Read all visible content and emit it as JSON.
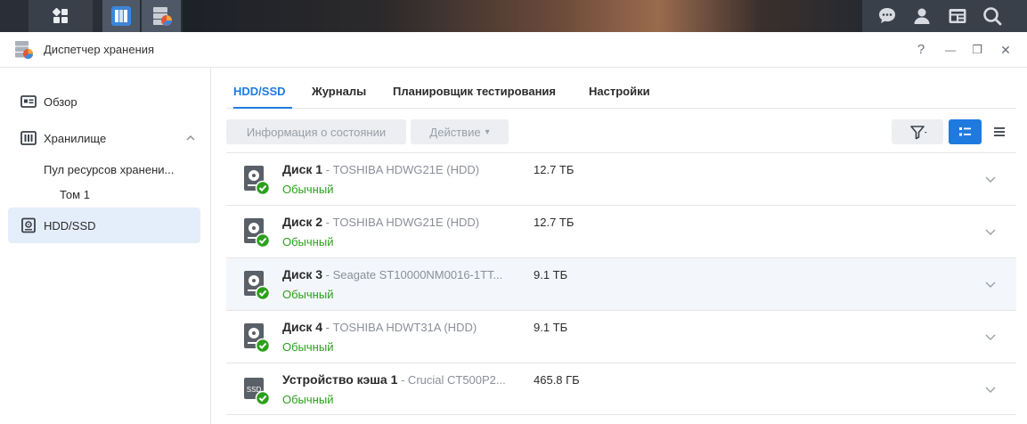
{
  "taskbar": {
    "main_menu_icon": "grid-icon",
    "apps": [
      "storage-manager-app-icon",
      "storage-manager-active-icon"
    ],
    "right_icons": [
      "chat-icon",
      "user-icon",
      "widgets-icon",
      "search-icon"
    ]
  },
  "window": {
    "title": "Диспетчер хранения",
    "controls": {
      "help": "?",
      "minimize": "—",
      "restore": "❐",
      "close": "✕"
    }
  },
  "sidebar": {
    "overview": "Обзор",
    "storage": "Хранилище",
    "pool": "Пул ресурсов хранени...",
    "volume": "Том 1",
    "hdd_ssd": "HDD/SSD"
  },
  "tabs": [
    {
      "label": "HDD/SSD",
      "active": true
    },
    {
      "label": "Журналы",
      "active": false
    },
    {
      "label": "Планировщик тестирования",
      "active": false
    },
    {
      "label": "Настройки",
      "active": false
    }
  ],
  "toolbar": {
    "health_info": "Информация о состоянии",
    "action": "Действие",
    "action_caret": "▾"
  },
  "disks": [
    {
      "name": "Диск 1",
      "model": " - TOSHIBA HDWG21E (HDD)",
      "size": "12.7 ТБ",
      "status": "Обычный",
      "type": "hdd"
    },
    {
      "name": "Диск 2",
      "model": " - TOSHIBA HDWG21E (HDD)",
      "size": "12.7 ТБ",
      "status": "Обычный",
      "type": "hdd"
    },
    {
      "name": "Диск 3",
      "model": " - Seagate ST10000NM0016-1TT...",
      "size": "9.1 ТБ",
      "status": "Обычный",
      "type": "hdd"
    },
    {
      "name": "Диск 4",
      "model": " - TOSHIBA HDWT31A (HDD)",
      "size": "9.1 ТБ",
      "status": "Обычный",
      "type": "hdd"
    },
    {
      "name": "Устройство кэша 1",
      "model": " - Crucial CT500P2...",
      "size": "465.8 ГБ",
      "status": "Обычный",
      "type": "ssd"
    }
  ],
  "colors": {
    "accent": "#1f7ae0",
    "ok": "#2ca01c",
    "taskbar": "#2a2f37"
  }
}
